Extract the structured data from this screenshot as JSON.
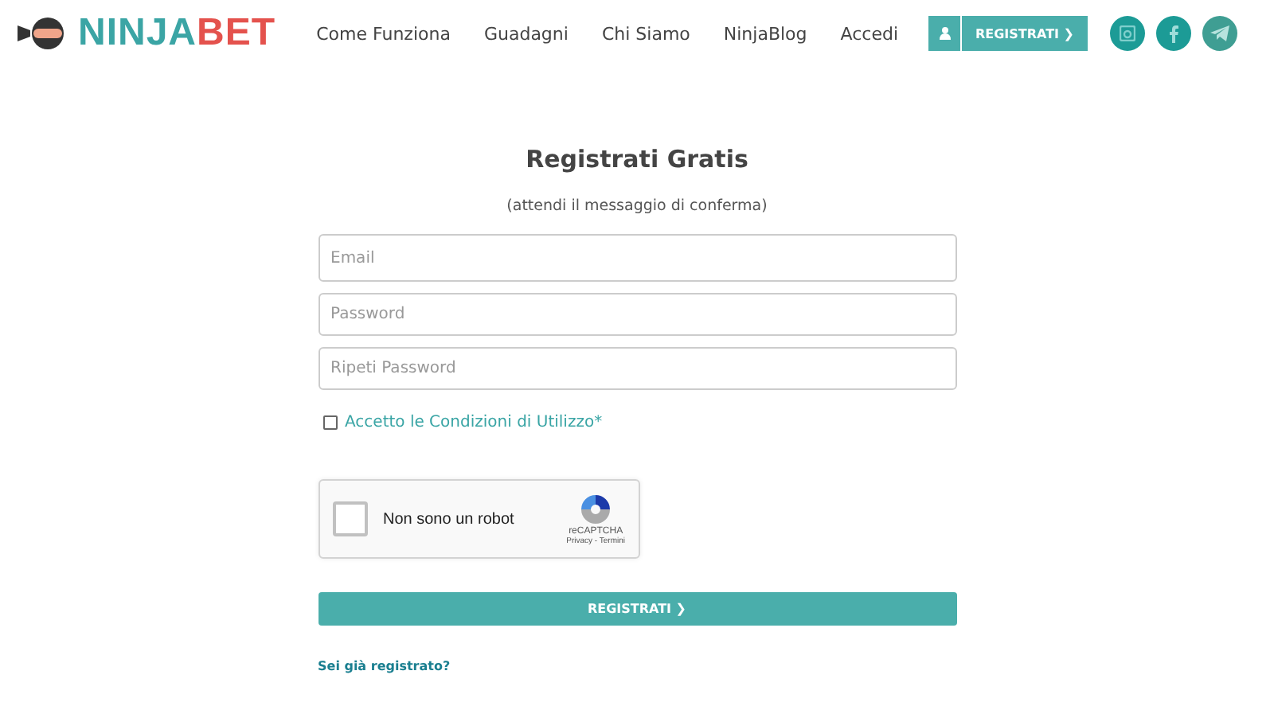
{
  "logo": {
    "first": "NINJA",
    "second": "BET"
  },
  "nav": [
    "Come Funziona",
    "Guadagni",
    "Chi Siamo",
    "NinjaBlog",
    "Accedi"
  ],
  "header_button": "REGISTRATI ❯",
  "form": {
    "title": "Registrati Gratis",
    "subtitle": "(attendi il messaggio di conferma)",
    "fields": [
      {
        "placeholder": "Email"
      },
      {
        "placeholder": "Password"
      },
      {
        "placeholder": "Ripeti Password"
      }
    ],
    "terms": {
      "checked": false,
      "label": "Accetto le Condizioni di Utilizzo",
      "mark": "*"
    },
    "captcha": {
      "checked": false,
      "label": "Non sono un robot",
      "brand": "reCAPTCHA",
      "links": "Privacy - Termini"
    },
    "submit": "REGISTRATI ❯",
    "login_link": "Sei già registrato?"
  }
}
